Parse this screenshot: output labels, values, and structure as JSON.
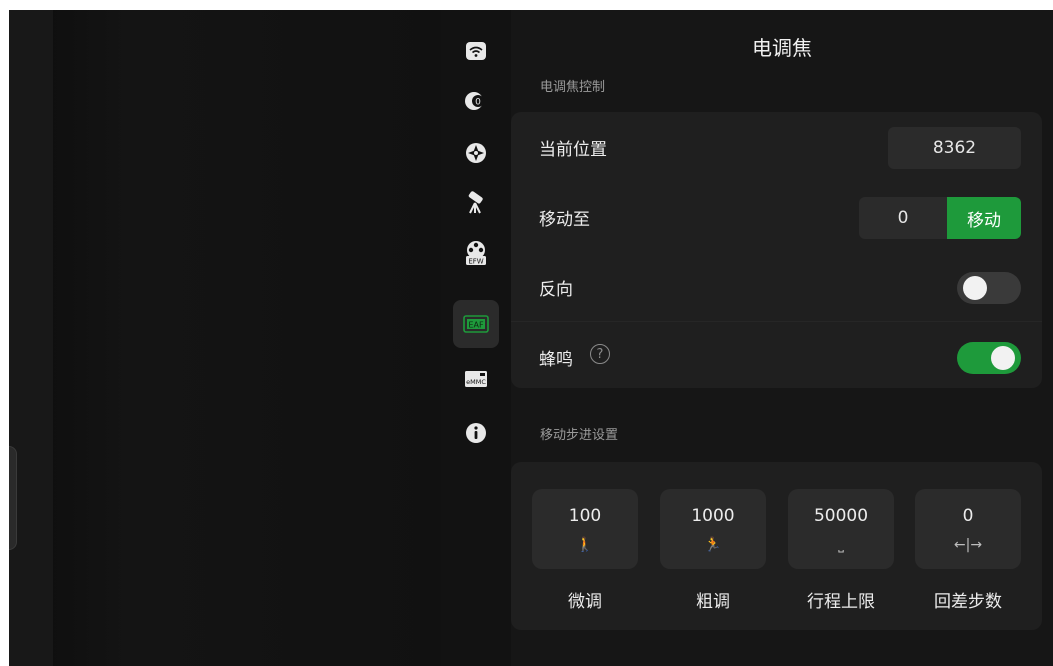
{
  "panel": {
    "title": "电调焦"
  },
  "nav": {
    "items": [
      {
        "name": "wifi-icon",
        "active": false
      },
      {
        "name": "camera-icon",
        "active": false
      },
      {
        "name": "mount-icon",
        "active": false
      },
      {
        "name": "telescope-icon",
        "active": false
      },
      {
        "name": "filter-wheel-icon",
        "label": "EFW",
        "active": false
      },
      {
        "name": "focuser-icon",
        "label": "EAF",
        "active": true
      },
      {
        "name": "storage-icon",
        "label": "eMMC",
        "active": false
      },
      {
        "name": "info-icon",
        "active": false
      }
    ]
  },
  "focuser_control": {
    "section_label": "电调焦控制",
    "current_position_label": "当前位置",
    "current_position_value": "8362",
    "move_to_label": "移动至",
    "move_to_value": "0",
    "move_button_label": "移动",
    "reverse_label": "反向",
    "reverse_on": false,
    "buzzer_label": "蜂鸣",
    "buzzer_help": "?",
    "buzzer_on": true
  },
  "step_settings": {
    "section_label": "移动步进设置",
    "steps": [
      {
        "value": "100",
        "icon": "walk-icon",
        "glyph": "🚶",
        "caption": "微调"
      },
      {
        "value": "1000",
        "icon": "run-icon",
        "glyph": "🏃",
        "caption": "粗调"
      },
      {
        "value": "50000",
        "icon": "range-icon",
        "glyph": "⎵",
        "caption": "行程上限"
      },
      {
        "value": "0",
        "icon": "backlash-icon",
        "glyph": "←|→",
        "caption": "回差步数"
      }
    ]
  },
  "colors": {
    "accent_green": "#1e9a3b",
    "panel_bg": "#161616",
    "card_bg": "#1f1f1f"
  }
}
